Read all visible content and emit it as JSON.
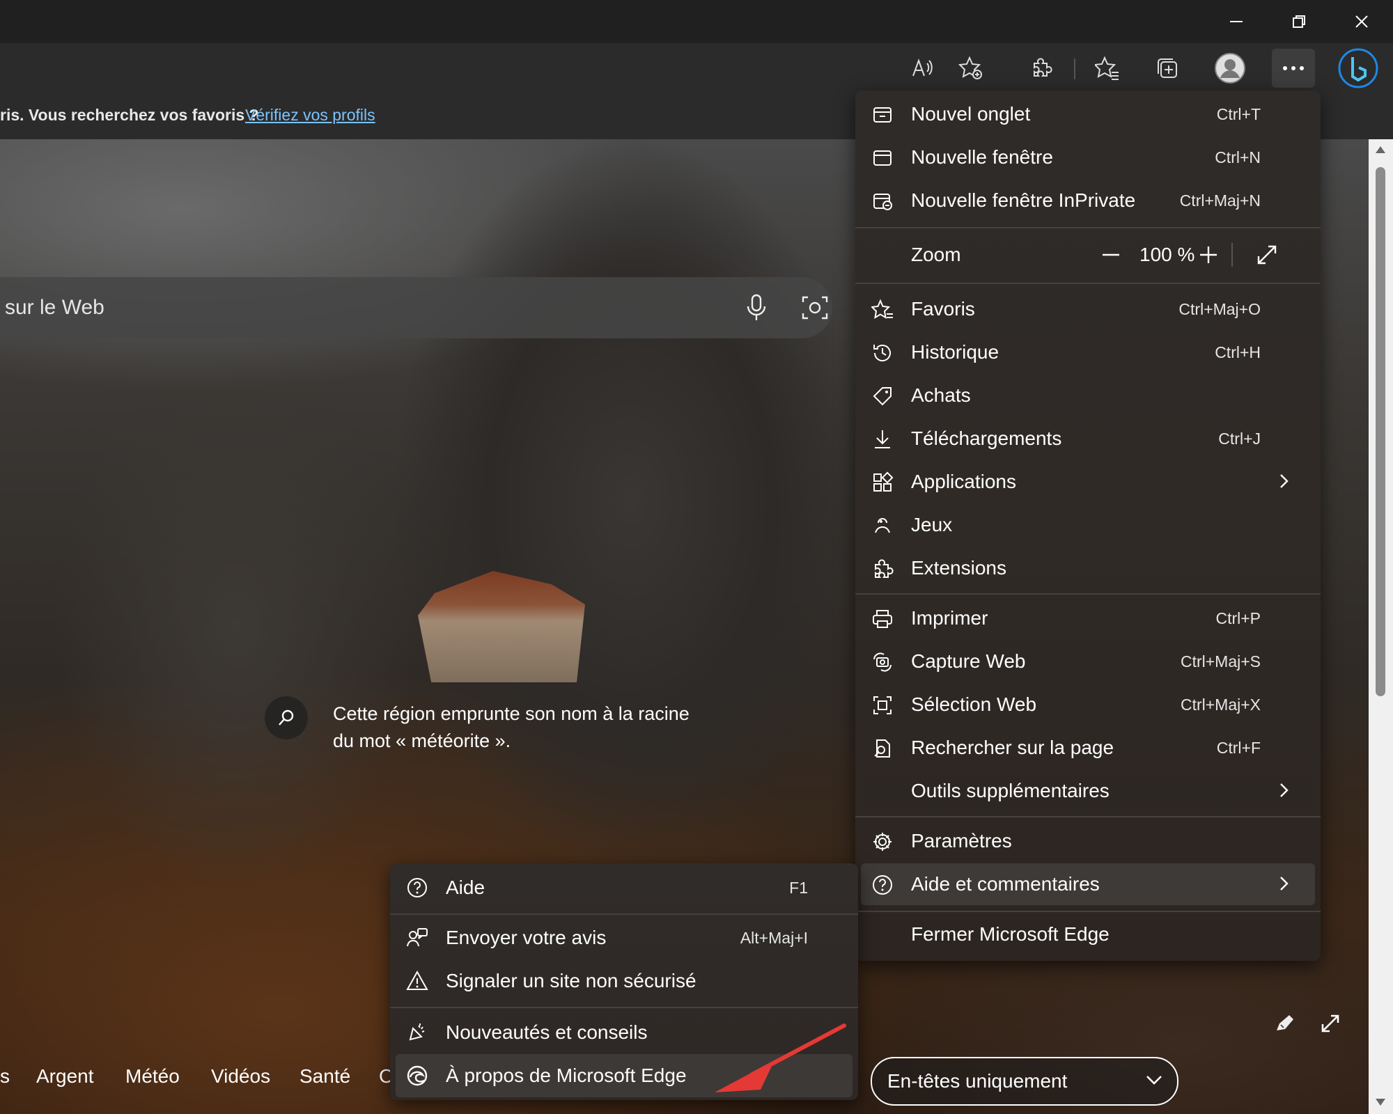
{
  "infobar": {
    "text": "ris. Vous recherchez vos favoris ?",
    "link": "Vérifiez vos profils"
  },
  "search": {
    "placeholder": "sur le Web"
  },
  "caption": {
    "text": "Cette région emprunte son nom à la racine du mot « météorite »."
  },
  "bottom_nav": {
    "items": [
      "s",
      "Argent",
      "Météo",
      "Vidéos",
      "Santé",
      "C"
    ],
    "layout_selected": "En-têtes uniquement"
  },
  "menu": {
    "items": [
      {
        "label": "Nouvel onglet",
        "shortcut": "Ctrl+T",
        "icon": "new-tab-icon"
      },
      {
        "label": "Nouvelle fenêtre",
        "shortcut": "Ctrl+N",
        "icon": "new-window-icon"
      },
      {
        "label": "Nouvelle fenêtre InPrivate",
        "shortcut": "Ctrl+Maj+N",
        "icon": "inprivate-icon"
      },
      {
        "label": "Favoris",
        "shortcut": "Ctrl+Maj+O",
        "icon": "favorites-icon"
      },
      {
        "label": "Historique",
        "shortcut": "Ctrl+H",
        "icon": "history-icon"
      },
      {
        "label": "Achats",
        "shortcut": "",
        "icon": "shopping-tag-icon"
      },
      {
        "label": "Téléchargements",
        "shortcut": "Ctrl+J",
        "icon": "download-icon"
      },
      {
        "label": "Applications",
        "shortcut": "",
        "icon": "apps-icon"
      },
      {
        "label": "Jeux",
        "shortcut": "",
        "icon": "games-icon"
      },
      {
        "label": "Extensions",
        "shortcut": "",
        "icon": "extensions-icon"
      },
      {
        "label": "Imprimer",
        "shortcut": "Ctrl+P",
        "icon": "print-icon"
      },
      {
        "label": "Capture Web",
        "shortcut": "Ctrl+Maj+S",
        "icon": "web-capture-icon"
      },
      {
        "label": "Sélection Web",
        "shortcut": "Ctrl+Maj+X",
        "icon": "web-select-icon"
      },
      {
        "label": "Rechercher sur la page",
        "shortcut": "Ctrl+F",
        "icon": "find-on-page-icon"
      },
      {
        "label": "Outils supplémentaires",
        "shortcut": "",
        "icon": ""
      },
      {
        "label": "Paramètres",
        "shortcut": "",
        "icon": "settings-gear-icon"
      },
      {
        "label": "Aide et commentaires",
        "shortcut": "",
        "icon": "help-icon"
      },
      {
        "label": "Fermer Microsoft Edge",
        "shortcut": "",
        "icon": ""
      }
    ],
    "zoom": {
      "label": "Zoom",
      "value": "100 %"
    }
  },
  "submenu": {
    "items": [
      {
        "label": "Aide",
        "shortcut": "F1",
        "icon": "help-icon"
      },
      {
        "label": "Envoyer votre avis",
        "shortcut": "Alt+Maj+I",
        "icon": "feedback-icon"
      },
      {
        "label": "Signaler un site non sécurisé",
        "shortcut": "",
        "icon": "warning-icon"
      },
      {
        "label": "Nouveautés et conseils",
        "shortcut": "",
        "icon": "whats-new-icon"
      },
      {
        "label": "À propos de Microsoft Edge",
        "shortcut": "",
        "icon": "edge-logo-icon"
      }
    ]
  },
  "colors": {
    "menu_bg": "#2e2b29",
    "link": "#7cc3ff",
    "annotation_arrow": "#e53935",
    "bing_accent": "#1e88e5"
  }
}
